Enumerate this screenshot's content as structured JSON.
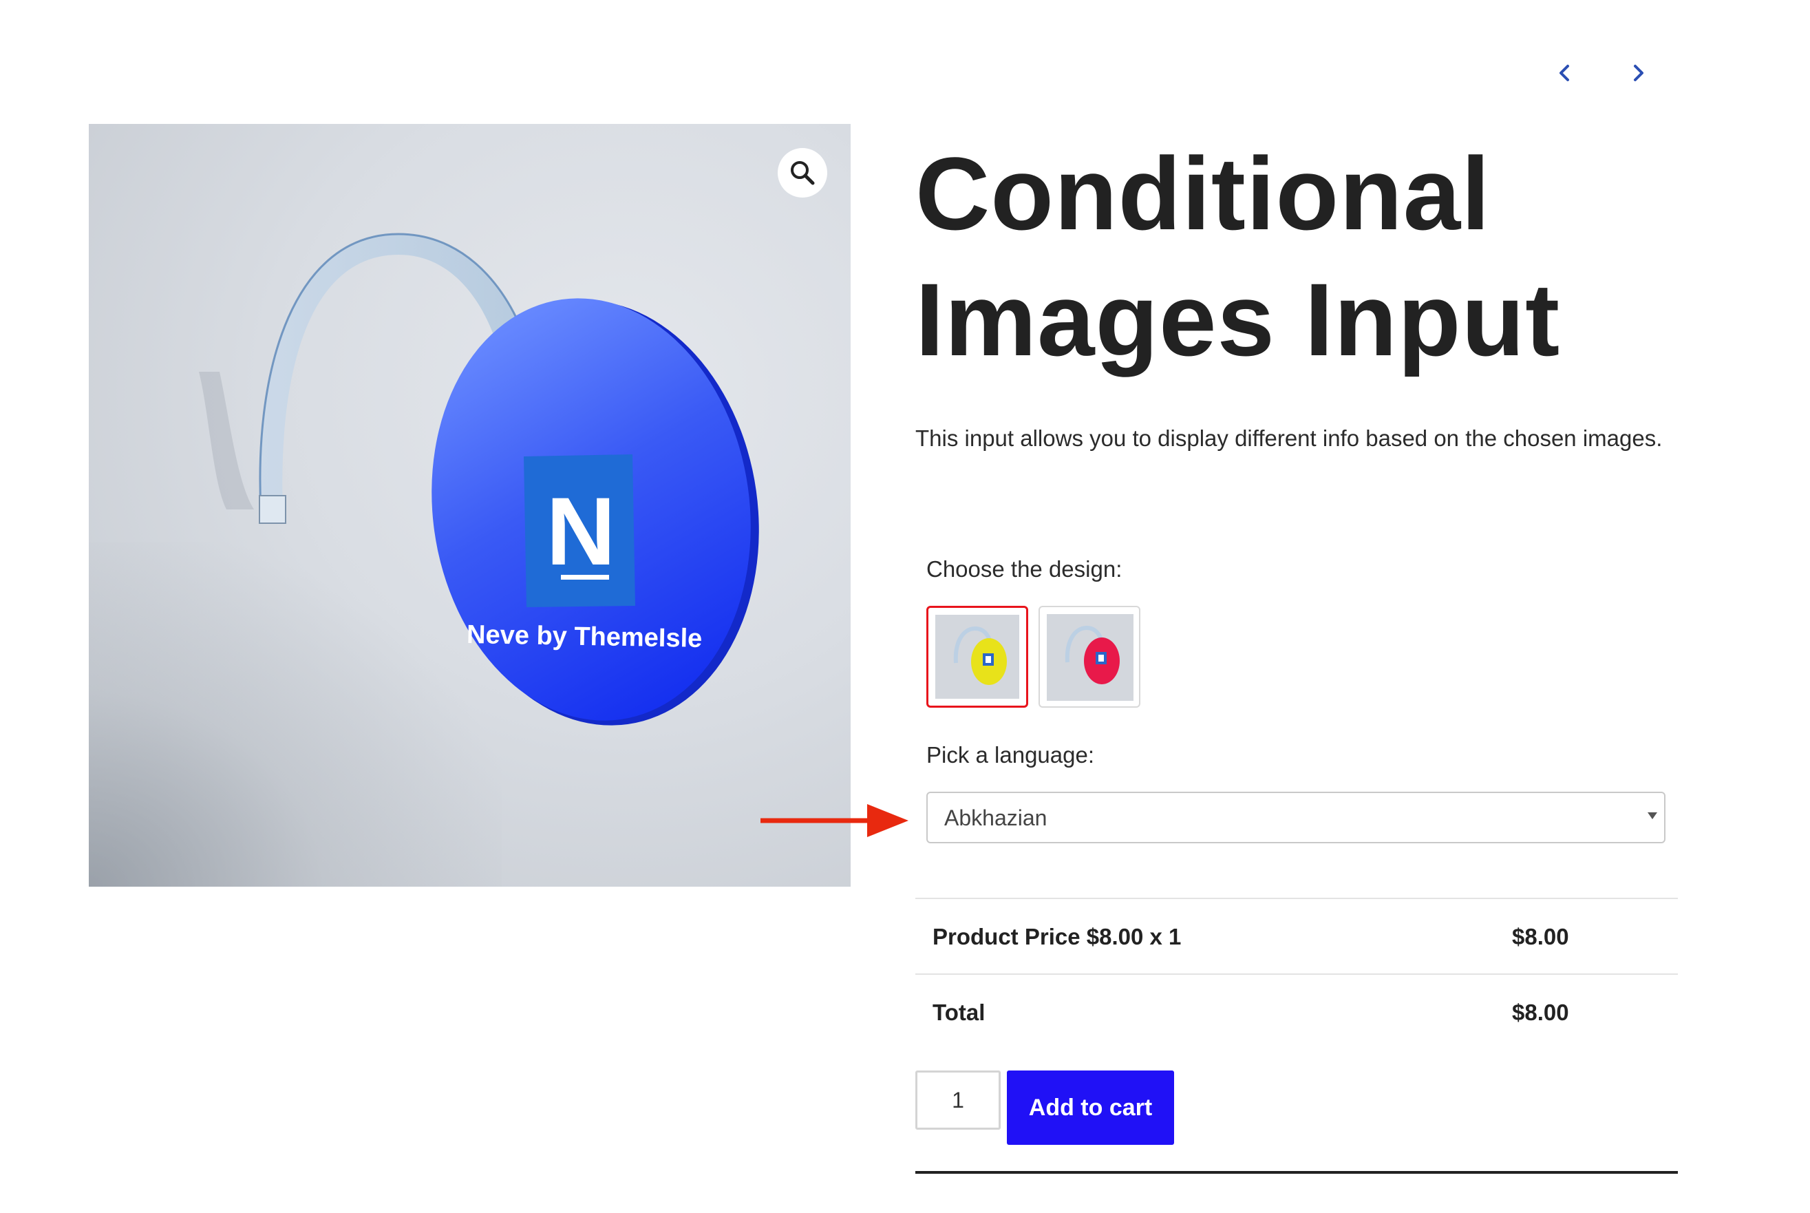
{
  "navigation": {
    "prev_icon": "chevron-left-icon",
    "next_icon": "chevron-right-icon",
    "accent_color": "#2b4fb3"
  },
  "product": {
    "title_line1": "Conditional",
    "title_line2": "Images Input",
    "description": "This input allows you to display different info based on the chosen images.",
    "image_brand_text": "Neve by ThemeIsle",
    "image_logo_letter": "N",
    "zoom_icon": "magnifier-icon"
  },
  "options": {
    "design_label": "Choose the design:",
    "design_swatches": [
      {
        "name": "yellow",
        "color": "#e8e21a",
        "selected": true
      },
      {
        "name": "red",
        "color": "#e8194a",
        "selected": false
      }
    ],
    "language_label": "Pick a language:",
    "language_selected": "Abkhazian"
  },
  "totals": {
    "rows": [
      {
        "label": "Product Price $8.00 x 1",
        "amount": "$8.00"
      },
      {
        "label": "Total",
        "amount": "$8.00"
      }
    ]
  },
  "cart": {
    "quantity": "1",
    "add_to_cart_label": "Add to cart",
    "button_color": "#2011f6"
  },
  "annotation": {
    "arrow_color": "#e8290f"
  }
}
